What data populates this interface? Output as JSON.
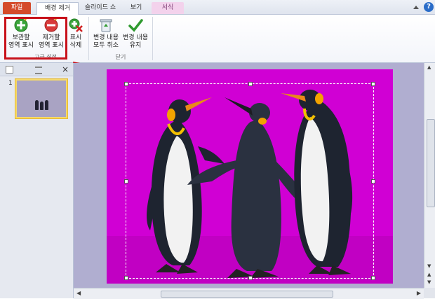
{
  "tabs": {
    "file": "파일",
    "background_removal": "배경 제거",
    "slideshow": "슬라이드 쇼",
    "view": "보기",
    "format": "서식"
  },
  "ribbon": {
    "mark_keep_label": "보관할\n영역 표시",
    "mark_remove_label": "제거할\n영역 표시",
    "delete_mark_label": "표시\n삭제",
    "group_refine_label": "고급 설정",
    "discard_changes_label": "변경 내용\n모두 취소",
    "keep_changes_label": "변경 내용\n유지",
    "group_close_label": "닫기"
  },
  "slides_pane": {
    "slide_number": "1"
  },
  "colors": {
    "accent": "#c8111a",
    "file_tab": "#d44a2a",
    "background_magenta": "#d000d4"
  }
}
